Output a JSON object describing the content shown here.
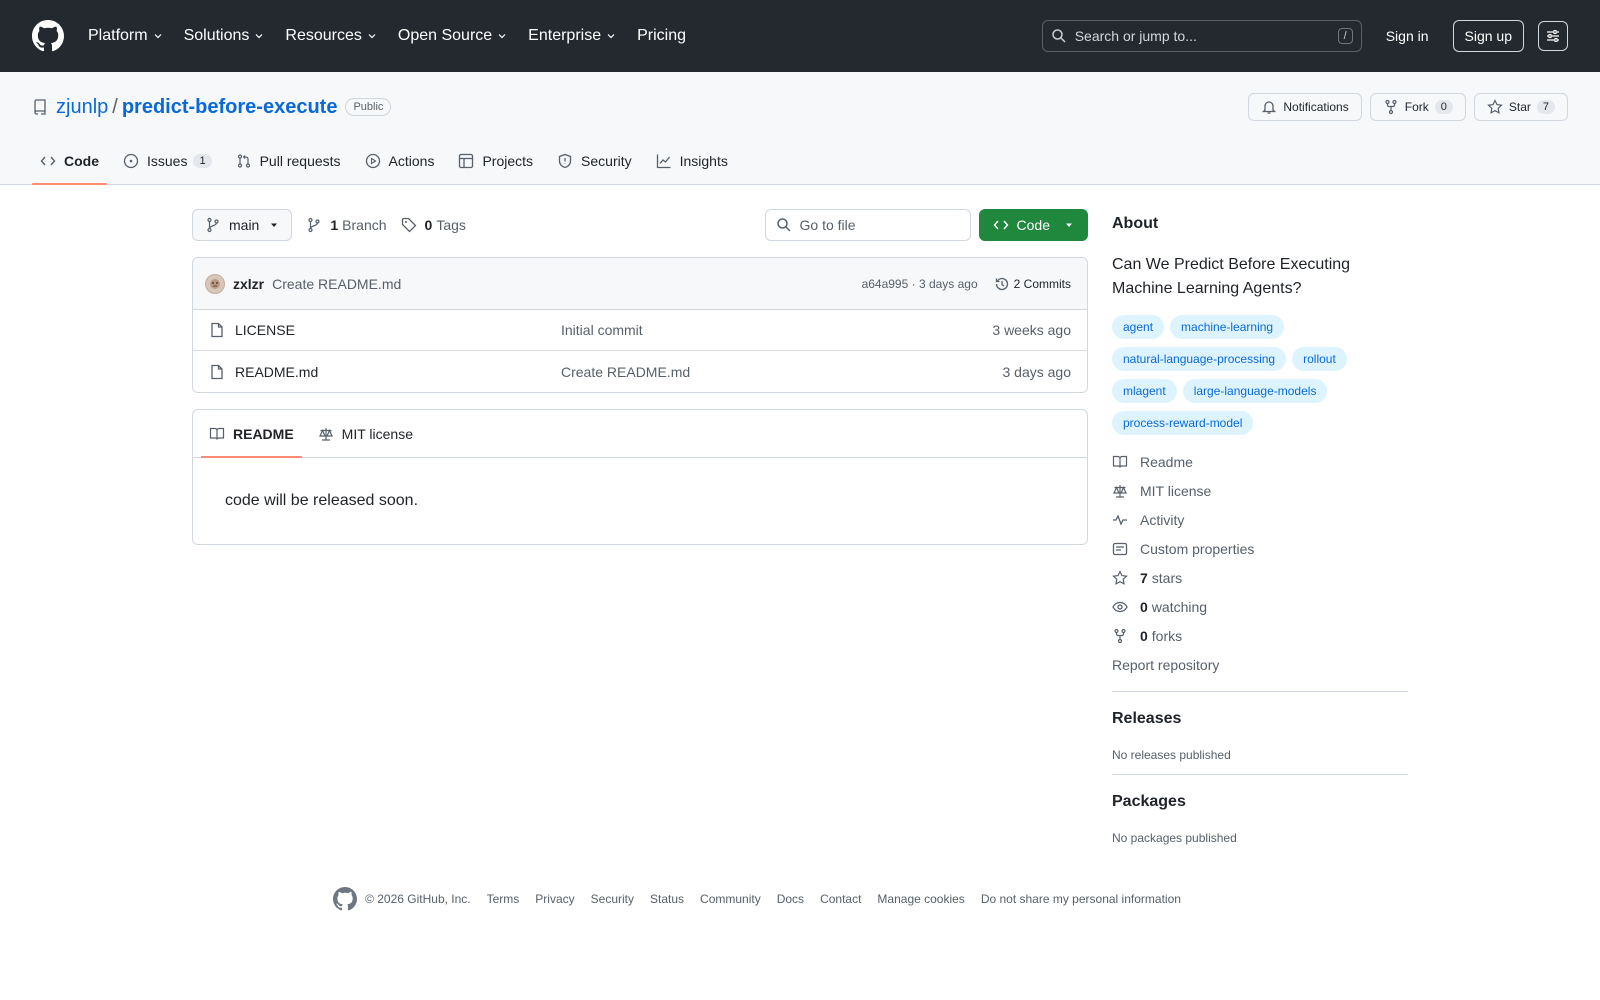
{
  "header": {
    "nav": [
      "Platform",
      "Solutions",
      "Resources",
      "Open Source",
      "Enterprise",
      "Pricing"
    ],
    "search_placeholder": "Search or jump to...",
    "search_key": "/",
    "sign_in": "Sign in",
    "sign_up": "Sign up"
  },
  "repo": {
    "owner": "zjunlp",
    "separator": "/",
    "name": "predict-before-execute",
    "visibility": "Public",
    "notifications_label": "Notifications",
    "fork_label": "Fork",
    "fork_count": "0",
    "star_label": "Star",
    "star_count": "7"
  },
  "tabs": [
    {
      "label": "Code",
      "icon": "code-icon"
    },
    {
      "label": "Issues",
      "icon": "issue-icon",
      "count": "1"
    },
    {
      "label": "Pull requests",
      "icon": "pull-request-icon"
    },
    {
      "label": "Actions",
      "icon": "play-icon"
    },
    {
      "label": "Projects",
      "icon": "table-icon"
    },
    {
      "label": "Security",
      "icon": "shield-icon"
    },
    {
      "label": "Insights",
      "icon": "graph-icon"
    }
  ],
  "toolbar": {
    "branch": "main",
    "branch_count": "1",
    "branch_label": "Branch",
    "tag_count": "0",
    "tag_label": "Tags",
    "goto_placeholder": "Go to file",
    "code_button": "Code"
  },
  "latest_commit": {
    "author": "zxlzr",
    "message": "Create README.md",
    "meta": "a64a995 · 3 days ago",
    "commits_label": "2 Commits"
  },
  "files": [
    {
      "name": "LICENSE",
      "commit": "Initial commit",
      "time": "3 weeks ago"
    },
    {
      "name": "README.md",
      "commit": "Create README.md",
      "time": "3 days ago"
    }
  ],
  "readme": {
    "tab_readme": "README",
    "tab_license": "MIT license",
    "body": "code will be released soon."
  },
  "about": {
    "title": "About",
    "description": "Can We Predict Before Executing Machine Learning Agents?",
    "topics": [
      "agent",
      "machine-learning",
      "natural-language-processing",
      "rollout",
      "mlagent",
      "large-language-models",
      "process-reward-model"
    ],
    "links": {
      "readme": "Readme",
      "license": "MIT license",
      "activity": "Activity",
      "custom_properties": "Custom properties",
      "stars_count": "7",
      "stars_label": "stars",
      "watching_count": "0",
      "watching_label": "watching",
      "forks_count": "0",
      "forks_label": "forks",
      "report": "Report repository"
    }
  },
  "releases": {
    "title": "Releases",
    "empty": "No releases published"
  },
  "packages": {
    "title": "Packages",
    "empty": "No packages published"
  },
  "footer": {
    "copyright": "© 2026 GitHub, Inc.",
    "links": [
      "Terms",
      "Privacy",
      "Security",
      "Status",
      "Community",
      "Docs",
      "Contact",
      "Manage cookies",
      "Do not share my personal information"
    ]
  },
  "colors": {
    "header_bg": "#24292f",
    "link": "#0969da",
    "primary_button": "#1f883d",
    "active_tab_underline": "#fd8c73",
    "topic_bg": "#ddf4ff"
  }
}
